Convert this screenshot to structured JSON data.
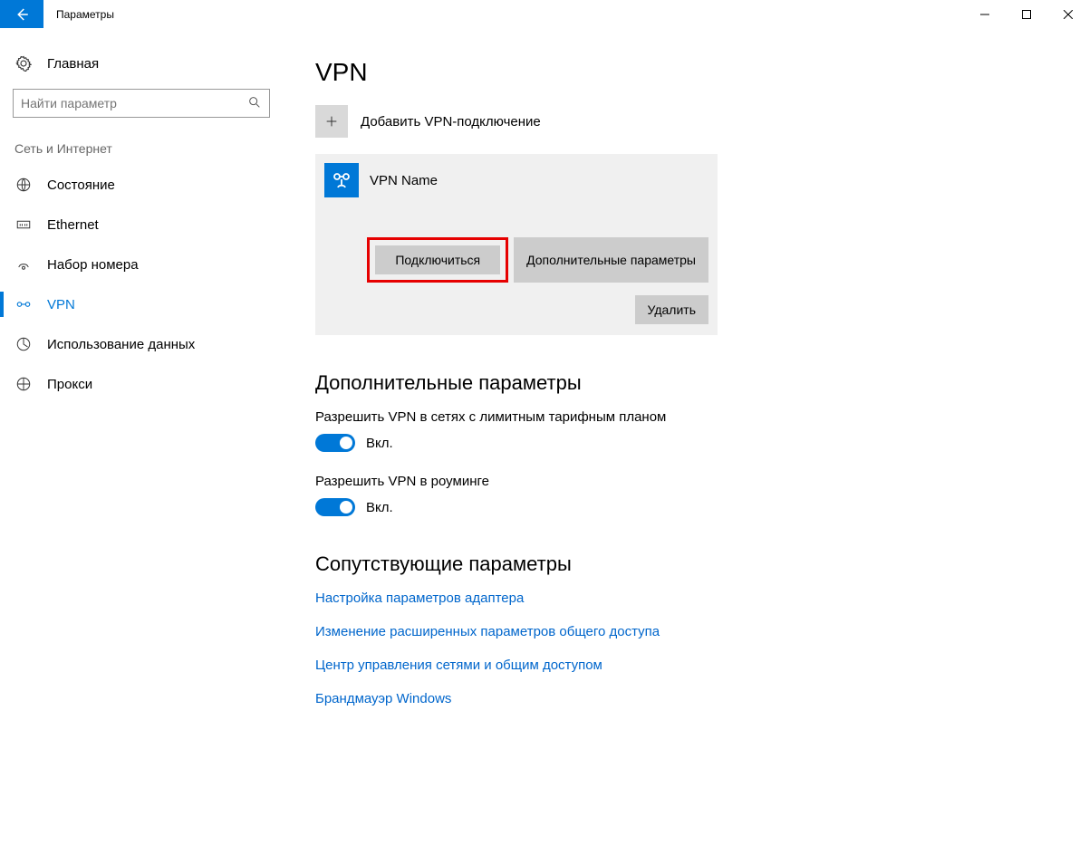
{
  "titlebar": {
    "title": "Параметры"
  },
  "sidebar": {
    "home": "Главная",
    "search_placeholder": "Найти параметр",
    "section": "Сеть и Интернет",
    "items": [
      {
        "label": "Состояние"
      },
      {
        "label": "Ethernet"
      },
      {
        "label": "Набор номера"
      },
      {
        "label": "VPN"
      },
      {
        "label": "Использование данных"
      },
      {
        "label": "Прокси"
      }
    ]
  },
  "main": {
    "heading": "VPN",
    "add_label": "Добавить VPN-подключение",
    "vpn": {
      "name": "VPN Name",
      "connect": "Подключиться",
      "advanced": "Дополнительные параметры",
      "delete": "Удалить"
    },
    "advanced_heading": "Дополнительные параметры",
    "toggles": [
      {
        "label": "Разрешить VPN в сетях с лимитным тарифным планом",
        "state": "Вкл."
      },
      {
        "label": "Разрешить VPN в роуминге",
        "state": "Вкл."
      }
    ],
    "related_heading": "Сопутствующие параметры",
    "links": [
      "Настройка параметров адаптера",
      "Изменение расширенных параметров общего доступа",
      "Центр управления сетями и общим доступом",
      "Брандмауэр Windows"
    ]
  }
}
